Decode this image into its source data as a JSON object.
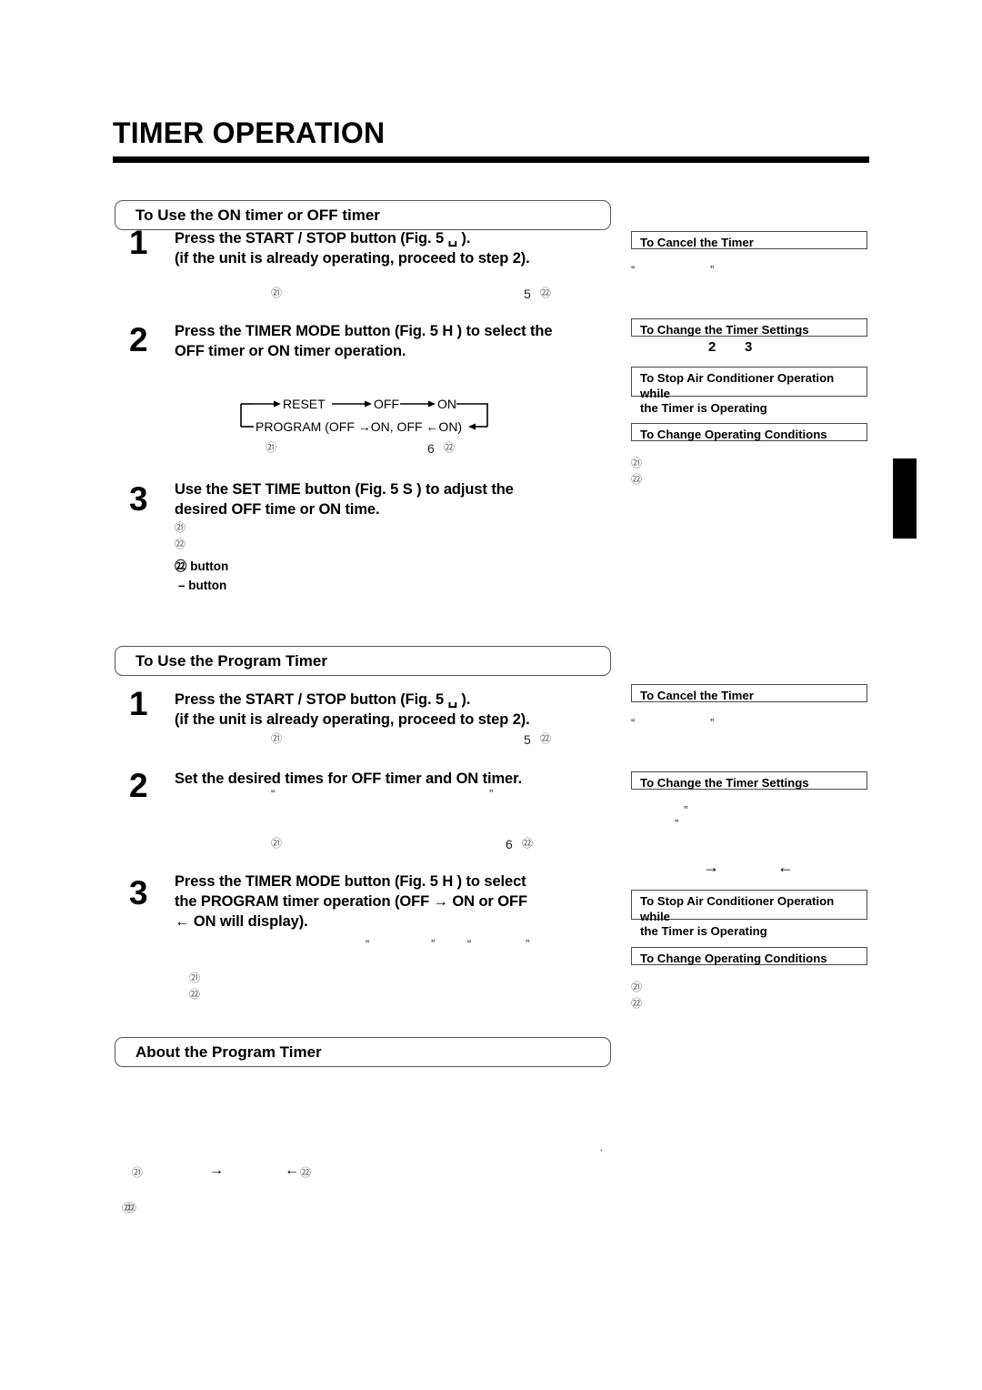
{
  "document": {
    "title": "TIMER OPERATION"
  },
  "sections": [
    {
      "header": "To Use the ON timer or OFF timer",
      "steps": [
        {
          "number": "1",
          "line1": "Press the START / STOP button (Fig. 5 ␣ ).",
          "line2": "(if the unit is already operating, proceed to step 2)."
        },
        {
          "number": "2",
          "line1": "Press the TIMER MODE button (Fig. 5 H ) to select the",
          "line2": "OFF timer or ON timer operation."
        },
        {
          "number": "3",
          "line1": "Use the SET TIME button (Fig. 5 S ) to adjust the",
          "line2": "desired OFF time or ON time."
        }
      ]
    },
    {
      "header": "To Use the Program Timer",
      "steps": [
        {
          "number": "1",
          "line1": "Press the START / STOP button (Fig. 5 ␣ ).",
          "line2": "(if the unit is already operating, proceed to step 2)."
        },
        {
          "number": "2",
          "line1": "Set the desired times for OFF timer and ON timer.",
          "line2": ""
        },
        {
          "number": "3",
          "line1": "Press the TIMER MODE button (Fig. 5 H ) to select",
          "line2": "the PROGRAM timer operation (OFF → ON or OFF",
          "line3": "← ON will display)."
        }
      ]
    },
    {
      "header": "About the Program Timer",
      "steps": []
    }
  ],
  "step_button_labels": {
    "label_25": "㉒ button",
    "label_minus": "– button"
  },
  "flow_diagram": {
    "top_row": [
      "RESET",
      "OFF",
      "ON"
    ],
    "bottom_row": "PROGRAM (OFF →ON, OFF ←ON)"
  },
  "right_boxes_group1": [
    {
      "label": "To Cancel the Timer"
    },
    {
      "label": "To Change the Timer Settings"
    },
    {
      "label": "To Stop Air Conditioner Operation while\nthe Timer is Operating"
    },
    {
      "label": "To Change Operating Conditions"
    }
  ],
  "right_boxes_group2": [
    {
      "label": "To Cancel the Timer"
    },
    {
      "label": "To Change the Timer Settings"
    },
    {
      "label": "To Stop Air Conditioner Operation while\nthe Timer is Operating"
    },
    {
      "label": "To Change Operating Conditions"
    }
  ],
  "reference_marks": {
    "c22": "㉑",
    "c23": "㉒",
    "c25": "㉔",
    "num5": "5",
    "num6": "6",
    "num2": "2",
    "num3": "3",
    "quote_open": "“",
    "quote_close": "”",
    "arrow_right": "→",
    "arrow_left": "←",
    "apostrophe": "’"
  },
  "colors": {
    "ink": "#000000",
    "box_border": "#4a4a4a",
    "rounded_border": "#555555",
    "muted": "#5a5a5a"
  }
}
